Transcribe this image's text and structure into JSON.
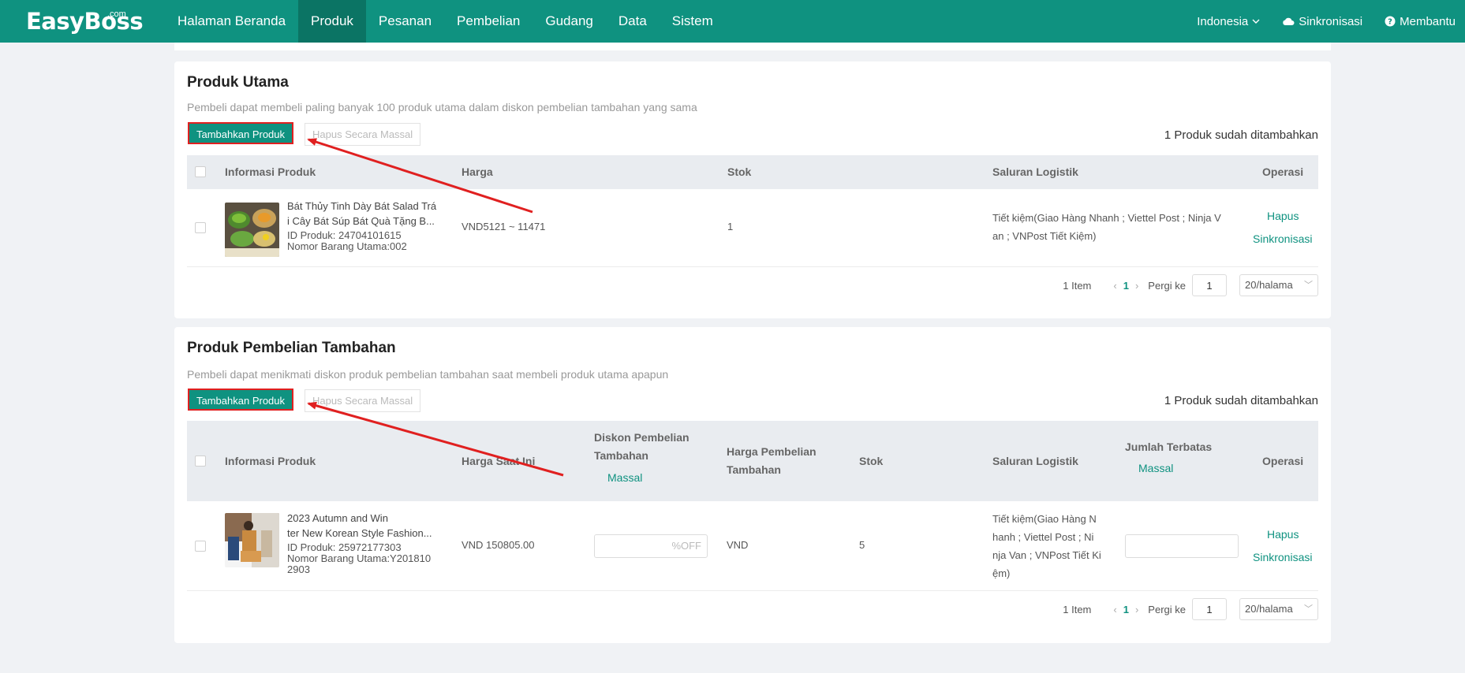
{
  "app": {
    "logo": "EasyBoss",
    "logo_suffix": ".com",
    "nav": [
      "Halaman Beranda",
      "Produk",
      "Pesanan",
      "Pembelian",
      "Gudang",
      "Data",
      "Sistem"
    ],
    "nav_active": "Produk",
    "language": "Indonesia",
    "sync": "Sinkronisasi",
    "help": "Membantu",
    "brand_color": "#0f9280"
  },
  "main_products": {
    "title": "Produk Utama",
    "description": "Pembeli dapat membeli paling banyak 100 produk utama dalam diskon pembelian tambahan yang sama",
    "add_button": "Tambahkan Produk",
    "bulk_delete_button": "Hapus Secara Massal",
    "added_count": "1 Produk sudah ditambahkan",
    "columns": [
      "Informasi Produk",
      "Harga",
      "Stok",
      "Saluran Logistik",
      "Operasi"
    ],
    "rows": [
      {
        "name_line1": "Bát Thủy Tinh Dày Bát Salad Trá",
        "name_line2": "i Cây Bát Súp Bát Quà Tặng B...",
        "product_id": "ID Produk: 24704101615",
        "sku": "Nomor Barang Utama:002",
        "price": "VND5121 ~ 11471",
        "stock": "1",
        "logistics_line1": "Tiết kiệm(Giao Hàng Nhanh ; Viettel Post ; Ninja V",
        "logistics_line2": "an ; VNPost Tiết Kiệm)",
        "op_delete": "Hapus",
        "op_sync": "Sinkronisasi"
      }
    ],
    "pagination": {
      "items": "1 Item",
      "current_page": "1",
      "goto_label": "Pergi ke",
      "goto_value": "1",
      "page_size": "20/halama"
    }
  },
  "addon_products": {
    "title": "Produk Pembelian Tambahan",
    "description": "Pembeli dapat menikmati diskon produk pembelian tambahan saat membeli produk utama apapun",
    "add_button": "Tambahkan Produk",
    "bulk_delete_button": "Hapus Secara Massal",
    "added_count": "1 Produk sudah ditambahkan",
    "columns": {
      "info": "Informasi Produk",
      "current_price": "Harga Saat Ini",
      "discount_line1": "Diskon Pembelian",
      "discount_line2": "Tambahan",
      "discount_bulk": "Massal",
      "addon_price_line1": "Harga Pembelian",
      "addon_price_line2": "Tambahan",
      "stock": "Stok",
      "logistics": "Saluran Logistik",
      "limit": "Jumlah Terbatas",
      "limit_bulk": "Massal",
      "operation": "Operasi"
    },
    "rows": [
      {
        "name_line1": "2023 Autumn and Win",
        "name_line2": "ter New Korean Style Fashion...",
        "product_id": "ID Produk: 25972177303",
        "sku_line1": "Nomor Barang Utama:Y201810",
        "sku_line2": "2903",
        "current_price": "VND 150805.00",
        "discount_placeholder": "%OFF",
        "addon_price": "VND",
        "stock": "5",
        "logistics_line1": "Tiết kiệm(Giao Hàng N",
        "logistics_line2": "hanh ; Viettel Post ; Ni",
        "logistics_line3": "nja Van ; VNPost Tiết Ki",
        "logistics_line4": "ệm)",
        "op_delete": "Hapus",
        "op_sync": "Sinkronisasi"
      }
    ],
    "pagination": {
      "items": "1 Item",
      "current_page": "1",
      "goto_label": "Pergi ke",
      "goto_value": "1",
      "page_size": "20/halama"
    }
  },
  "annotations": {
    "arrow_color": "#e02020"
  }
}
